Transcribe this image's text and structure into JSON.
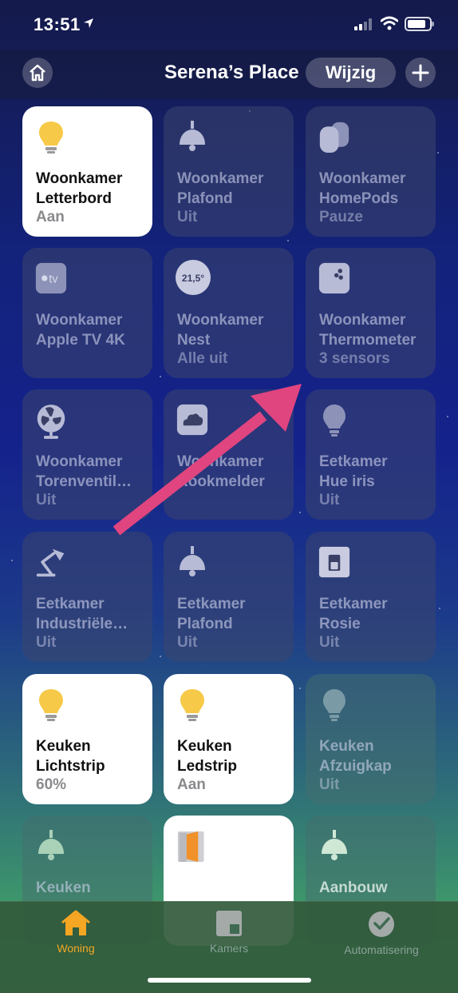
{
  "status_bar": {
    "time": "13:51"
  },
  "nav": {
    "title": "Serena’s Place",
    "edit_label": "Wijzig"
  },
  "tiles": [
    {
      "name1": "Woonkamer",
      "name2": "Letterbord",
      "state": "Aan",
      "icon": "bulb-icon",
      "on": true
    },
    {
      "name1": "Woonkamer",
      "name2": "Plafond",
      "state": "Uit",
      "icon": "ceiling-lamp-icon",
      "on": false
    },
    {
      "name1": "Woonkamer",
      "name2": "HomePods",
      "state": "Pauze",
      "icon": "homepod-icon",
      "on": false
    },
    {
      "name1": "Woonkamer",
      "name2": "Apple TV 4K",
      "state": "",
      "icon": "apple-tv-icon",
      "icon_text": "tv",
      "on": false
    },
    {
      "name1": "Woonkamer",
      "name2": "Nest",
      "state": "Alle uit",
      "icon": "thermostat-icon",
      "icon_text": "21,5°",
      "on": false
    },
    {
      "name1": "Woonkamer",
      "name2": "Thermometer",
      "state": "3 sensors",
      "icon": "sensor-icon",
      "on": false
    },
    {
      "name1": "Woonkamer",
      "name2": "Torenventil…",
      "state": "Uit",
      "icon": "fan-icon",
      "on": false
    },
    {
      "name1": "Woonkamer",
      "name2": "Rookmelder",
      "state": "",
      "icon": "smoke-detector-icon",
      "on": false
    },
    {
      "name1": "Eetkamer",
      "name2": "Hue iris",
      "state": "Uit",
      "icon": "bulb-icon",
      "on": false
    },
    {
      "name1": "Eetkamer",
      "name2": "Industriële…",
      "state": "Uit",
      "icon": "desk-lamp-icon",
      "on": false
    },
    {
      "name1": "Eetkamer",
      "name2": "Plafond",
      "state": "Uit",
      "icon": "ceiling-lamp-icon",
      "on": false
    },
    {
      "name1": "Eetkamer",
      "name2": "Rosie",
      "state": "Uit",
      "icon": "switch-icon",
      "on": false
    },
    {
      "name1": "Keuken",
      "name2": "Lichtstrip",
      "state": "60%",
      "icon": "bulb-icon",
      "on": true
    },
    {
      "name1": "Keuken",
      "name2": "Ledstrip",
      "state": "Aan",
      "icon": "bulb-icon",
      "on": true
    },
    {
      "name1": "Keuken",
      "name2": "Afzuigkap",
      "state": "Uit",
      "icon": "bulb-icon",
      "on": false
    },
    {
      "name1": "Keuken",
      "name2": "",
      "state": "",
      "icon": "ceiling-lamp-icon",
      "on": false
    },
    {
      "name1": "",
      "name2": "",
      "state": "",
      "icon": "door-icon",
      "on": true
    },
    {
      "name1": "Aanbouw",
      "name2": "",
      "state": "",
      "icon": "ceiling-lamp-icon",
      "on": false
    }
  ],
  "tabs": [
    {
      "label": "Woning",
      "icon": "house-icon",
      "active": true
    },
    {
      "label": "Kamers",
      "icon": "rooms-icon",
      "active": false
    },
    {
      "label": "Automatisering",
      "icon": "clock-check-icon",
      "active": false
    }
  ],
  "colors": {
    "accent": "#f5a623",
    "bulb_on": "#f7c948",
    "tile_on": "#ffffff"
  }
}
